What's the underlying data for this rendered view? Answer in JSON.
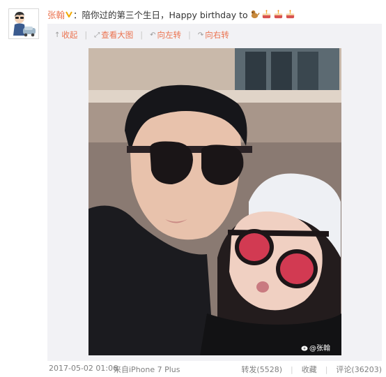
{
  "post": {
    "username": "张翰",
    "text": "：陪你过的第三个生日，Happy birthday to",
    "emojis": [
      "dog-icon",
      "cake-icon",
      "cake-icon",
      "cake-icon"
    ]
  },
  "toolbar": {
    "collapse": "收起",
    "view_large": "查看大图",
    "rotate_left": "向左转",
    "rotate_right": "向右转"
  },
  "photo": {
    "watermark": "@张翰"
  },
  "footer": {
    "timestamp": "2017-05-02 01:06",
    "source": "来自iPhone 7 Plus",
    "repost": "转发(5528)",
    "favorite": "收藏",
    "comment": "评论(36203)"
  },
  "colors": {
    "username": "#eb7350",
    "link": "#eb7350",
    "meta": "#808080",
    "media_bg": "#f2f2f5"
  }
}
